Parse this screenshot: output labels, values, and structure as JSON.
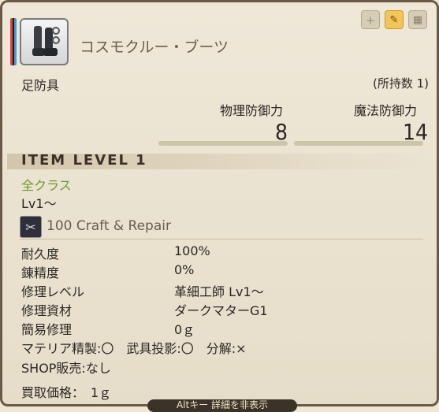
{
  "item": {
    "name": "コスモクルー・ブーツ",
    "slot": "足防具",
    "owned": "(所持数 1)",
    "rarity_colors": [
      "#e04040",
      "#1a1a1a",
      "#3aa0d0"
    ]
  },
  "stats": {
    "physical_label": "物理防御力",
    "physical_value": "8",
    "magic_label": "魔法防御力",
    "magic_value": "14"
  },
  "item_level": "ITEM LEVEL 1",
  "classes": "全クラス",
  "level_req": "Lv1～",
  "craft": {
    "icon": "needle-thread-icon",
    "label": "100 Craft & Repair"
  },
  "attributes": [
    {
      "label": "耐久度",
      "value": "100%"
    },
    {
      "label": "錬精度",
      "value": "0%"
    },
    {
      "label": "修理レベル",
      "value": "革細工師 Lv1～"
    },
    {
      "label": "修理資材",
      "value": "ダークマターG1"
    },
    {
      "label": "簡易修理",
      "value": "0ｇ"
    }
  ],
  "flags": "マテリア精製:〇　武具投影:〇　分解:×",
  "shop": "SHOP販売:なし",
  "price": "買取価格：　1ｇ",
  "hint": "Altキー 詳細を非表示",
  "top_icons": [
    "plus-icon",
    "glamour-icon",
    "equip-icon"
  ],
  "colors": {
    "class_text": "#6b9a2e",
    "panel_bg": "#efe8d8",
    "highlight_icon": "#f2c65a"
  }
}
